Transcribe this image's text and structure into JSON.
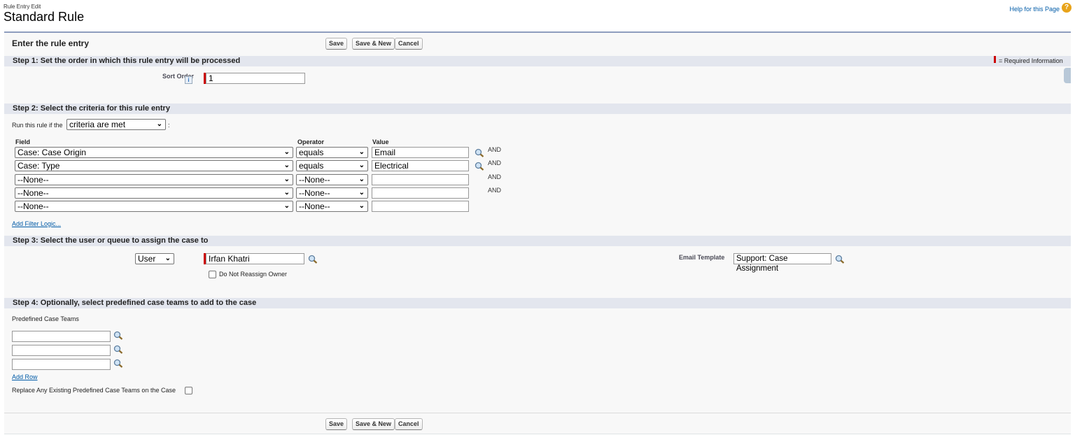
{
  "page": {
    "subtitle": "Rule Entry Edit",
    "title": "Standard Rule",
    "help_link": "Help for this Page"
  },
  "header": {
    "title": "Enter the rule entry",
    "save": "Save",
    "save_new": "Save & New",
    "cancel": "Cancel",
    "required_info": "= Required Information"
  },
  "step1": {
    "title": "Step 1: Set the order in which this rule entry will be processed",
    "sort_order_label": "Sort Order",
    "sort_order_value": "1"
  },
  "step2": {
    "title": "Step 2: Select the criteria for this rule entry",
    "run_label": "Run this rule if the",
    "run_value": "criteria are met",
    "run_suffix": ":",
    "col_field": "Field",
    "col_operator": "Operator",
    "col_value": "Value",
    "rows": [
      {
        "field": "Case: Case Origin",
        "operator": "equals",
        "value": "Email",
        "and": "AND"
      },
      {
        "field": "Case: Type",
        "operator": "equals",
        "value": "Electrical",
        "and": "AND"
      },
      {
        "field": "--None--",
        "operator": "--None--",
        "value": "",
        "and": "AND"
      },
      {
        "field": "--None--",
        "operator": "--None--",
        "value": "",
        "and": "AND"
      },
      {
        "field": "--None--",
        "operator": "--None--",
        "value": "",
        "and": ""
      }
    ],
    "add_filter_logic": "Add Filter Logic..."
  },
  "step3": {
    "title": "Step 3: Select the user or queue to assign the case to",
    "assignee_type": "User",
    "assignee": "Irfan Khatri",
    "do_not_reassign": "Do Not Reassign Owner",
    "email_template_label": "Email Template",
    "email_template": "Support: Case Assignment"
  },
  "step4": {
    "title": "Step 4: Optionally, select predefined case teams to add to the case",
    "teams_label": "Predefined Case Teams",
    "teams": [
      "",
      "",
      ""
    ],
    "add_row": "Add Row",
    "replace_label": "Replace Any Existing Predefined Case Teams on the Case"
  },
  "footer": {
    "save": "Save",
    "save_new": "Save & New",
    "cancel": "Cancel"
  },
  "colors": {
    "accent": "#8e9dbe",
    "section_bg": "#e3e6ee",
    "required": "#cc0000",
    "link": "#015ba7"
  }
}
